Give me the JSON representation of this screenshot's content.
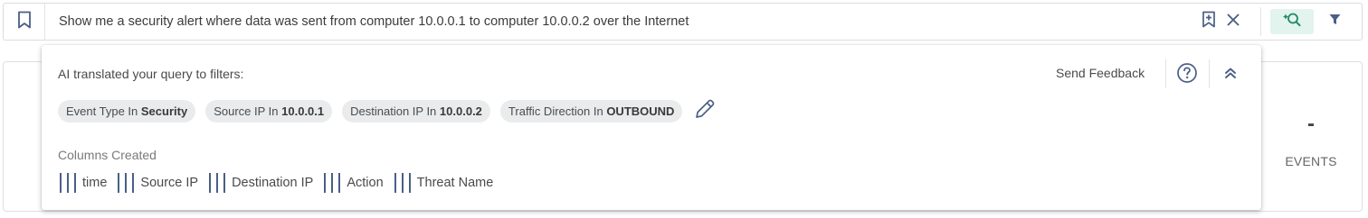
{
  "search": {
    "query": "Show me a security alert where data was sent from computer 10.0.0.1 to computer 10.0.0.2 over the Internet"
  },
  "summary": {
    "events_value": "-",
    "events_label": "EVENTS"
  },
  "ai_panel": {
    "title": "AI translated your query to filters:",
    "feedback_label": "Send Feedback",
    "filters": [
      {
        "field": "Event Type In",
        "value": "Security"
      },
      {
        "field": "Source IP In",
        "value": "10.0.0.1"
      },
      {
        "field": "Destination IP In",
        "value": "10.0.0.2"
      },
      {
        "field": "Traffic Direction In",
        "value": "OUTBOUND"
      }
    ],
    "columns_heading": "Columns Created",
    "columns": [
      "time",
      "Source IP",
      "Destination IP",
      "Action",
      "Threat Name"
    ]
  },
  "colors": {
    "accent_green": "#1f8a64",
    "ai_button_bg": "#e3f3ee",
    "icon_blue": "#4a5f86",
    "chip_bg": "#e9ebed"
  },
  "icons": {
    "bookmark": "bookmark-icon",
    "save_query": "bookmark-plus-icon",
    "clear": "close-icon",
    "ai_search": "ai-search-icon",
    "filter": "filter-icon",
    "help": "help-circle-icon",
    "collapse": "chevrons-up-icon",
    "edit": "pencil-icon",
    "column": "column-bars-icon"
  }
}
